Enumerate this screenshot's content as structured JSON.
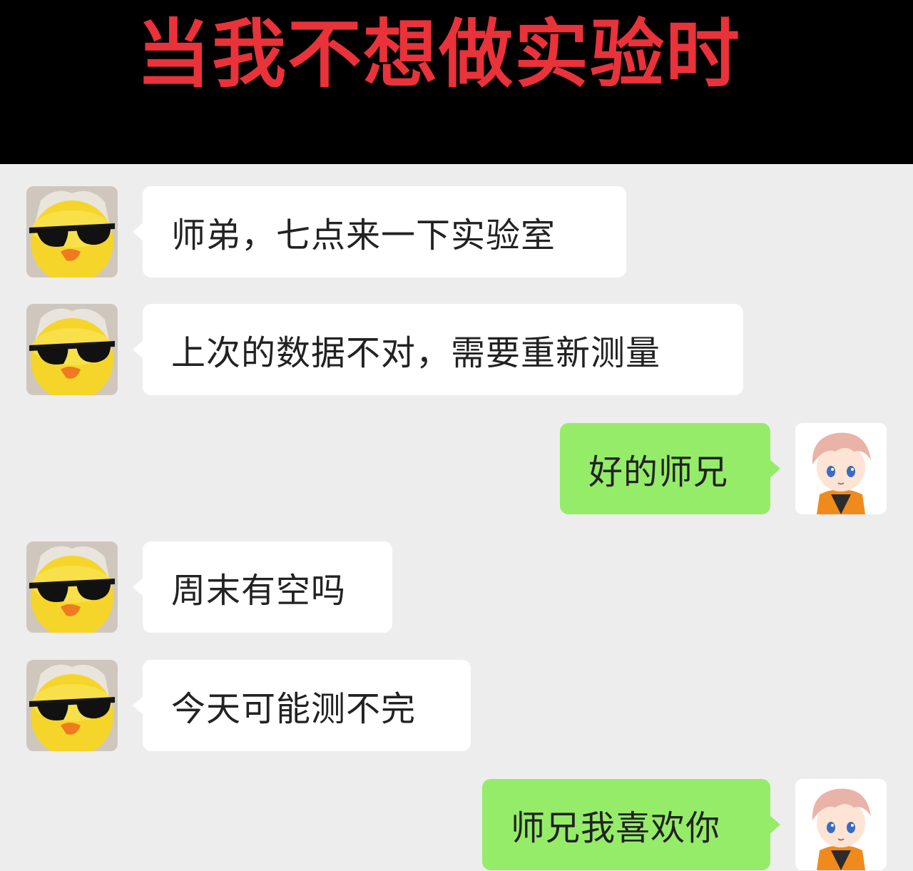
{
  "header": {
    "title": "当我不想做实验时"
  },
  "messages": [
    {
      "side": "in",
      "avatar": "duck-sunglasses-avatar",
      "text": "师弟，七点来一下实验室"
    },
    {
      "side": "in",
      "avatar": "duck-sunglasses-avatar",
      "text": "上次的数据不对，需要重新测量"
    },
    {
      "side": "out",
      "avatar": "anime-boy-avatar",
      "text": "好的师兄"
    },
    {
      "side": "in",
      "avatar": "duck-sunglasses-avatar",
      "text": "周末有空吗"
    },
    {
      "side": "in",
      "avatar": "duck-sunglasses-avatar",
      "text": "今天可能测不完"
    },
    {
      "side": "out",
      "avatar": "anime-boy-avatar",
      "text": "师兄我喜欢你"
    }
  ],
  "colors": {
    "title": "#e9323a",
    "header_bg": "#000000",
    "chat_bg": "#ededed",
    "incoming_bubble": "#ffffff",
    "outgoing_bubble": "#95ec69"
  }
}
